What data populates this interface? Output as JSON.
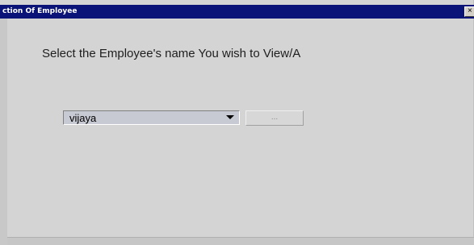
{
  "window": {
    "title": "ction Of Employee"
  },
  "main": {
    "instruction": "Select the Employee's name You wish to View/A",
    "employee_select": {
      "selected": "vijaya"
    },
    "browse_button_label": "..."
  },
  "colors": {
    "titlebar": "#0a1478",
    "window_bg": "#d4d4d4",
    "combo_bg": "#c7c9d3"
  }
}
